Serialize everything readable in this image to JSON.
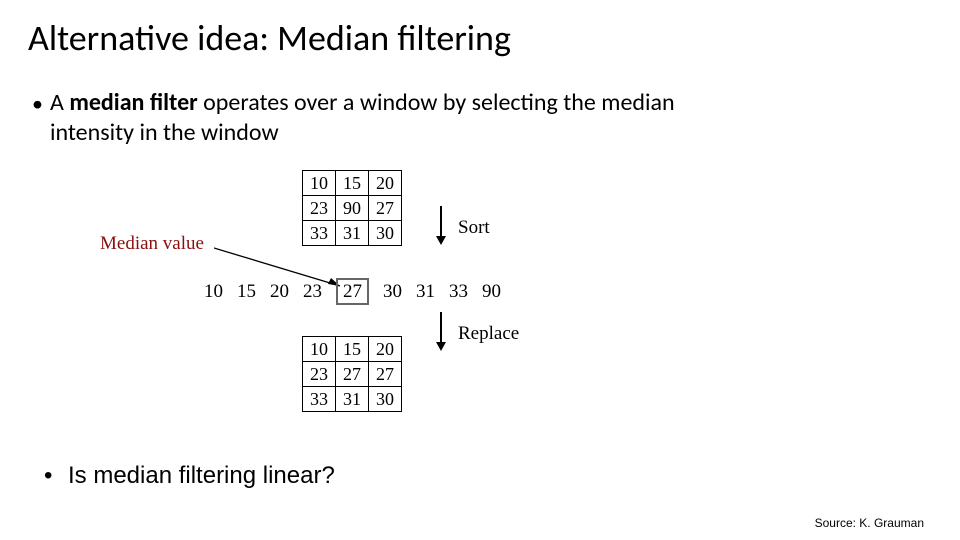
{
  "title": "Alternative idea: Median filtering",
  "bullet1_prefix": "A ",
  "bullet1_bold": "median filter",
  "bullet1_rest": " operates over a window by selecting the median intensity in the window",
  "bullet2": "Is median filtering linear?",
  "source": "Source: K. Grauman",
  "labels": {
    "median_value": "Median value",
    "sort": "Sort",
    "replace": "Replace"
  },
  "grid_top": [
    [
      "10",
      "15",
      "20"
    ],
    [
      "23",
      "90",
      "27"
    ],
    [
      "33",
      "31",
      "30"
    ]
  ],
  "grid_bottom": [
    [
      "10",
      "15",
      "20"
    ],
    [
      "23",
      "27",
      "27"
    ],
    [
      "33",
      "31",
      "30"
    ]
  ],
  "sorted": [
    "10",
    "15",
    "20",
    "23",
    "27",
    "30",
    "31",
    "33",
    "90"
  ],
  "median_index": 4
}
